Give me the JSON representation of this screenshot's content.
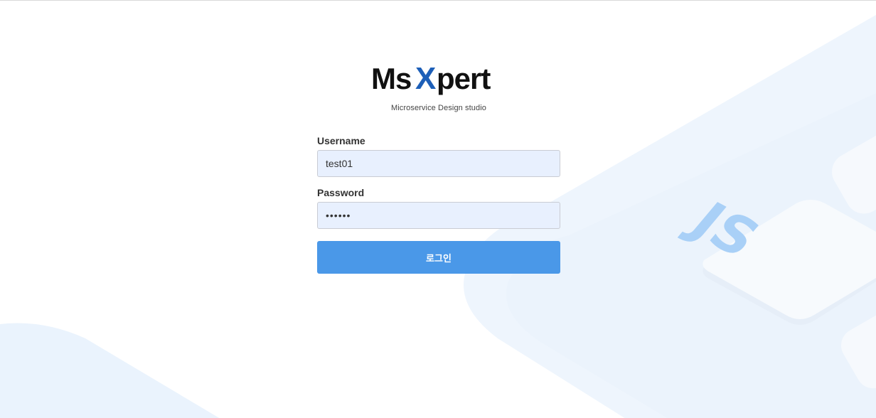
{
  "brand": {
    "logo_text_ms": "Ms",
    "logo_text_x": "X",
    "logo_text_pert": "pert",
    "subtitle": "Microservice Design studio"
  },
  "form": {
    "username_label": "Username",
    "username_value": "test01",
    "password_label": "Password",
    "password_value": "••••••",
    "login_button": "로그인"
  },
  "background": {
    "badge_text": "JS",
    "icon": "javascript-badge-icon"
  },
  "colors": {
    "accent": "#4a98e8",
    "input_bg": "#e8f0fe",
    "logo_dark": "#111111",
    "logo_blue": "#1d5fb8"
  }
}
